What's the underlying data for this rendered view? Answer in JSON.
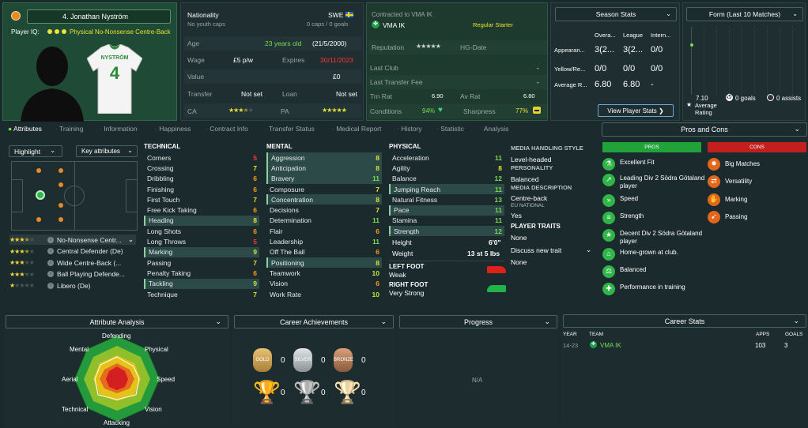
{
  "player": {
    "number_name": "4. Jonathan Nyström",
    "iq_label": "Player IQ:",
    "iq_role": "Physical No-Nonsense Centre-Back",
    "shirt_name": "NYSTRÖM",
    "shirt_number": "4"
  },
  "info": {
    "nationality_label": "Nationality",
    "nationality_value": "SWE",
    "youth_caps": "No youth caps",
    "caps": "0 caps / 0 goals",
    "age_label": "Age",
    "age_value": "23 years old",
    "dob": "(21/5/2000)",
    "wage_label": "Wage",
    "wage_value": "£5 p/w",
    "expires_label": "Expires",
    "expires_value": "30/11/2023",
    "value_label": "Value",
    "value_value": "£0",
    "transfer_label": "Transfer",
    "transfer_value": "Not set",
    "loan_label": "Loan",
    "loan_value": "Not set",
    "ca_label": "CA",
    "pa_label": "PA"
  },
  "contract": {
    "contracted_to": "Contracted to VMA IK",
    "club": "VMA IK",
    "status": "Regular Starter",
    "reputation_label": "Reputation",
    "hg_label": "HG-Date",
    "last_club_label": "Last Club",
    "last_club_value": "-",
    "last_transfer_label": "Last Transfer Fee",
    "last_transfer_value": "-",
    "trn_rat_label": "Trn Rat",
    "trn_rat_value": "6.90",
    "av_rat_label": "Av Rat",
    "av_rat_value": "6.80",
    "conditions_label": "Conditions",
    "conditions_value": "94%",
    "sharpness_label": "Sharpness",
    "sharpness_value": "77%"
  },
  "season": {
    "title": "Season Stats",
    "cols": [
      "Overa...",
      "League",
      "Intern..."
    ],
    "rows": [
      {
        "label": "Appearan...",
        "v": [
          "3(2...",
          "3(2...",
          "0/0"
        ]
      },
      {
        "label": "Yellow/Re...",
        "v": [
          "0/0",
          "0/0",
          "0/0"
        ]
      },
      {
        "label": "Average R...",
        "v": [
          "6.80",
          "6.80",
          "-"
        ]
      }
    ],
    "view_button": "View Player Stats ❯"
  },
  "form": {
    "title": "Form (Last 10 Matches)",
    "avg_value": "7.10",
    "avg_label": "Average Rating",
    "goals": "0 goals",
    "assists": "0 assists"
  },
  "tabs": [
    "Attributes",
    "Training",
    "Information",
    "Happiness",
    "Contract Info",
    "Transfer Status",
    "Medical Report",
    "History",
    "Statistic",
    "Analysis"
  ],
  "controls": {
    "highlight": "Highlight",
    "key_attributes": "Key attributes"
  },
  "roles": [
    {
      "name": "No-Nonsense Centr...",
      "stars": 3.5
    },
    {
      "name": "Central Defender (De)",
      "stars": 3.5
    },
    {
      "name": "Wide Centre-Back (...",
      "stars": 3
    },
    {
      "name": "Ball Playing Defende...",
      "stars": 3
    },
    {
      "name": "Libero (De)",
      "stars": 1
    }
  ],
  "technical": {
    "title": "TECHNICAL",
    "items": [
      {
        "n": "Corners",
        "v": "5"
      },
      {
        "n": "Crossing",
        "v": "7"
      },
      {
        "n": "Dribbling",
        "v": "6"
      },
      {
        "n": "Finishing",
        "v": "6"
      },
      {
        "n": "First Touch",
        "v": "7"
      },
      {
        "n": "Free Kick Taking",
        "v": "6"
      },
      {
        "n": "Heading",
        "v": "8"
      },
      {
        "n": "Long Shots",
        "v": "6"
      },
      {
        "n": "Long Throws",
        "v": "5"
      },
      {
        "n": "Marking",
        "v": "9"
      },
      {
        "n": "Passing",
        "v": "7"
      },
      {
        "n": "Penalty Taking",
        "v": "6"
      },
      {
        "n": "Tackling",
        "v": "9"
      },
      {
        "n": "Technique",
        "v": "7"
      }
    ]
  },
  "mental": {
    "title": "MENTAL",
    "items": [
      {
        "n": "Aggression",
        "v": "8"
      },
      {
        "n": "Anticipation",
        "v": "8"
      },
      {
        "n": "Bravery",
        "v": "11"
      },
      {
        "n": "Composure",
        "v": "7"
      },
      {
        "n": "Concentration",
        "v": "8"
      },
      {
        "n": "Decisions",
        "v": "7"
      },
      {
        "n": "Determination",
        "v": "11"
      },
      {
        "n": "Flair",
        "v": "6"
      },
      {
        "n": "Leadership",
        "v": "11"
      },
      {
        "n": "Off The Ball",
        "v": "6"
      },
      {
        "n": "Positioning",
        "v": "8"
      },
      {
        "n": "Teamwork",
        "v": "10"
      },
      {
        "n": "Vision",
        "v": "6"
      },
      {
        "n": "Work Rate",
        "v": "10"
      }
    ]
  },
  "physical": {
    "title": "PHYSICAL",
    "items": [
      {
        "n": "Acceleration",
        "v": "11"
      },
      {
        "n": "Agility",
        "v": "8"
      },
      {
        "n": "Balance",
        "v": "12"
      },
      {
        "n": "Jumping Reach",
        "v": "11"
      },
      {
        "n": "Natural Fitness",
        "v": "13"
      },
      {
        "n": "Pace",
        "v": "11"
      },
      {
        "n": "Stamina",
        "v": "11"
      },
      {
        "n": "Strength",
        "v": "12"
      }
    ],
    "height_label": "Height",
    "height_value": "6'0\"",
    "weight_label": "Weight",
    "weight_value": "13 st 5 lbs",
    "left_foot_label": "LEFT FOOT",
    "left_foot_value": "Weak",
    "right_foot_label": "RIGHT FOOT",
    "right_foot_value": "Very Strong"
  },
  "media": {
    "handling_title": "MEDIA HANDLING STYLE",
    "handling_value": "Level-headed",
    "personality_title": "PERSONALITY",
    "personality_value": "Balanced",
    "description_title": "MEDIA DESCRIPTION",
    "description_value": "Centre-back",
    "eu_title": "EU NATIONAL",
    "eu_value": "Yes",
    "traits_title": "PLAYER TRAITS",
    "traits_value": "None",
    "discuss": "Discuss new trait",
    "discuss_value": "None"
  },
  "pros_cons": {
    "title": "Pros and Cons",
    "pros_label": "PROS",
    "cons_label": "CONS",
    "pros": [
      "Excellent Fit",
      "Leading Div 2 Södra Götaland player",
      "Speed",
      "Strength",
      "Decent Div 2 Södra Götaland player",
      "Home-grown at club.",
      "Balanced",
      "Performance in training"
    ],
    "cons": [
      "Big Matches",
      "Versatility",
      "Marking",
      "Passing"
    ]
  },
  "attribute_analysis": {
    "title": "Attribute Analysis",
    "axes": [
      "Defending",
      "Physical",
      "Speed",
      "Vision",
      "Attacking",
      "Technical",
      "Aerial",
      "Mental"
    ]
  },
  "achievements": {
    "title": "Career Achievements",
    "medals": [
      "0",
      "0",
      "0"
    ],
    "trophies": [
      "0",
      "0",
      "0"
    ]
  },
  "progress": {
    "title": "Progress",
    "na": "N/A"
  },
  "career": {
    "title": "Career Stats",
    "cols": [
      "YEAR",
      "TEAM",
      "APPS",
      "GOALS"
    ],
    "rows": [
      {
        "year": "14-23",
        "team": "VMA IK",
        "apps": "103",
        "goals": "3"
      }
    ]
  },
  "colors": {
    "pros": "#21a33a",
    "cons": "#c21f1f",
    "accent_green": "#7adc52"
  }
}
